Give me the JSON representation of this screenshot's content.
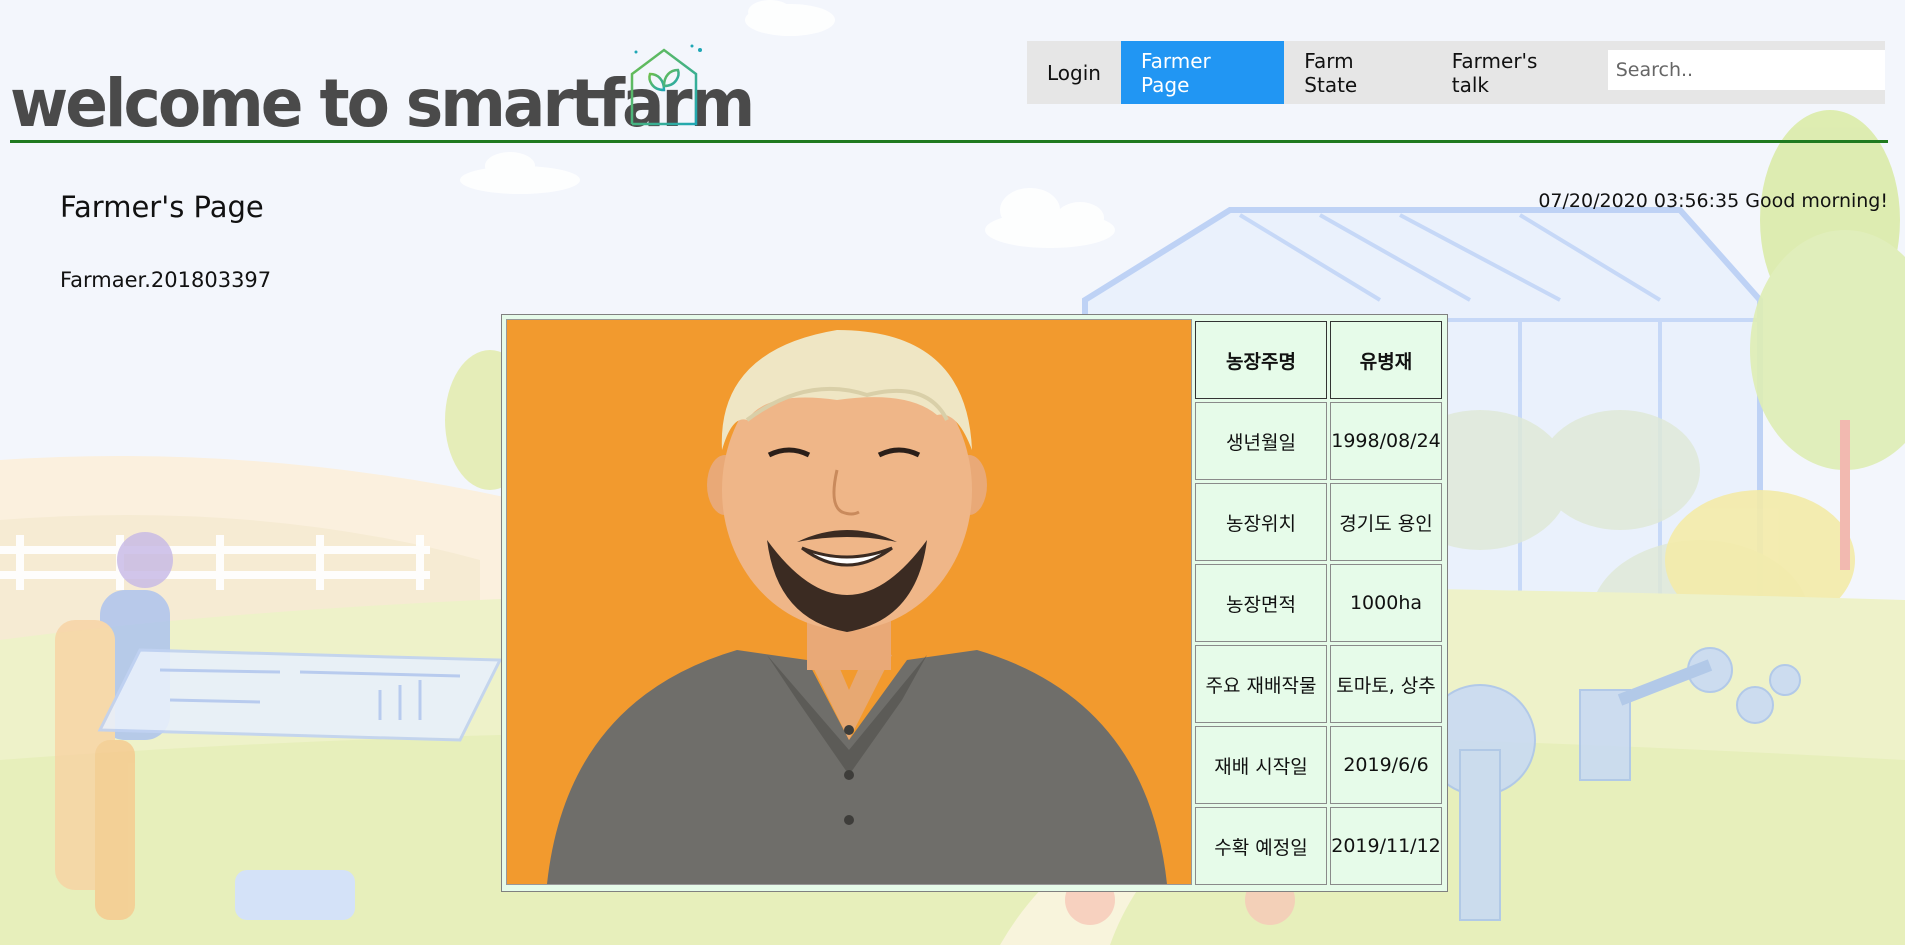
{
  "header": {
    "site_title": "welcome to smartfarm",
    "logo_icon": "greenhouse-leaf-icon"
  },
  "nav": {
    "items": [
      {
        "label": "Login",
        "active": false
      },
      {
        "label": "Farmer Page",
        "active": true
      },
      {
        "label": "Farm State",
        "active": false
      },
      {
        "label": "Farmer's talk",
        "active": false
      }
    ],
    "search_placeholder": "Search..",
    "active_color": "#2196F3"
  },
  "page": {
    "title": "Farmer's Page",
    "farmer_id": "Farmaer.201803397",
    "datetime_greeting": "07/20/2020 03:56:35 Good morning!"
  },
  "profile": {
    "photo": "farmer-portrait",
    "rows": [
      {
        "label": "농장주명",
        "value": "유병재"
      },
      {
        "label": "생년월일",
        "value": "1998/08/24"
      },
      {
        "label": "농장위치",
        "value": "경기도 용인"
      },
      {
        "label": "농장면적",
        "value": "1000ha"
      },
      {
        "label": "주요 재배작물",
        "value": "토마토, 상추"
      },
      {
        "label": "재배 시작일",
        "value": "2019/6/6"
      },
      {
        "label": "수확 예정일",
        "value": "2019/11/12"
      }
    ]
  },
  "colors": {
    "header_rule": "#1f7a1f",
    "table_bg": "#e6fbe9",
    "photo_bg": "#f29a2e"
  }
}
